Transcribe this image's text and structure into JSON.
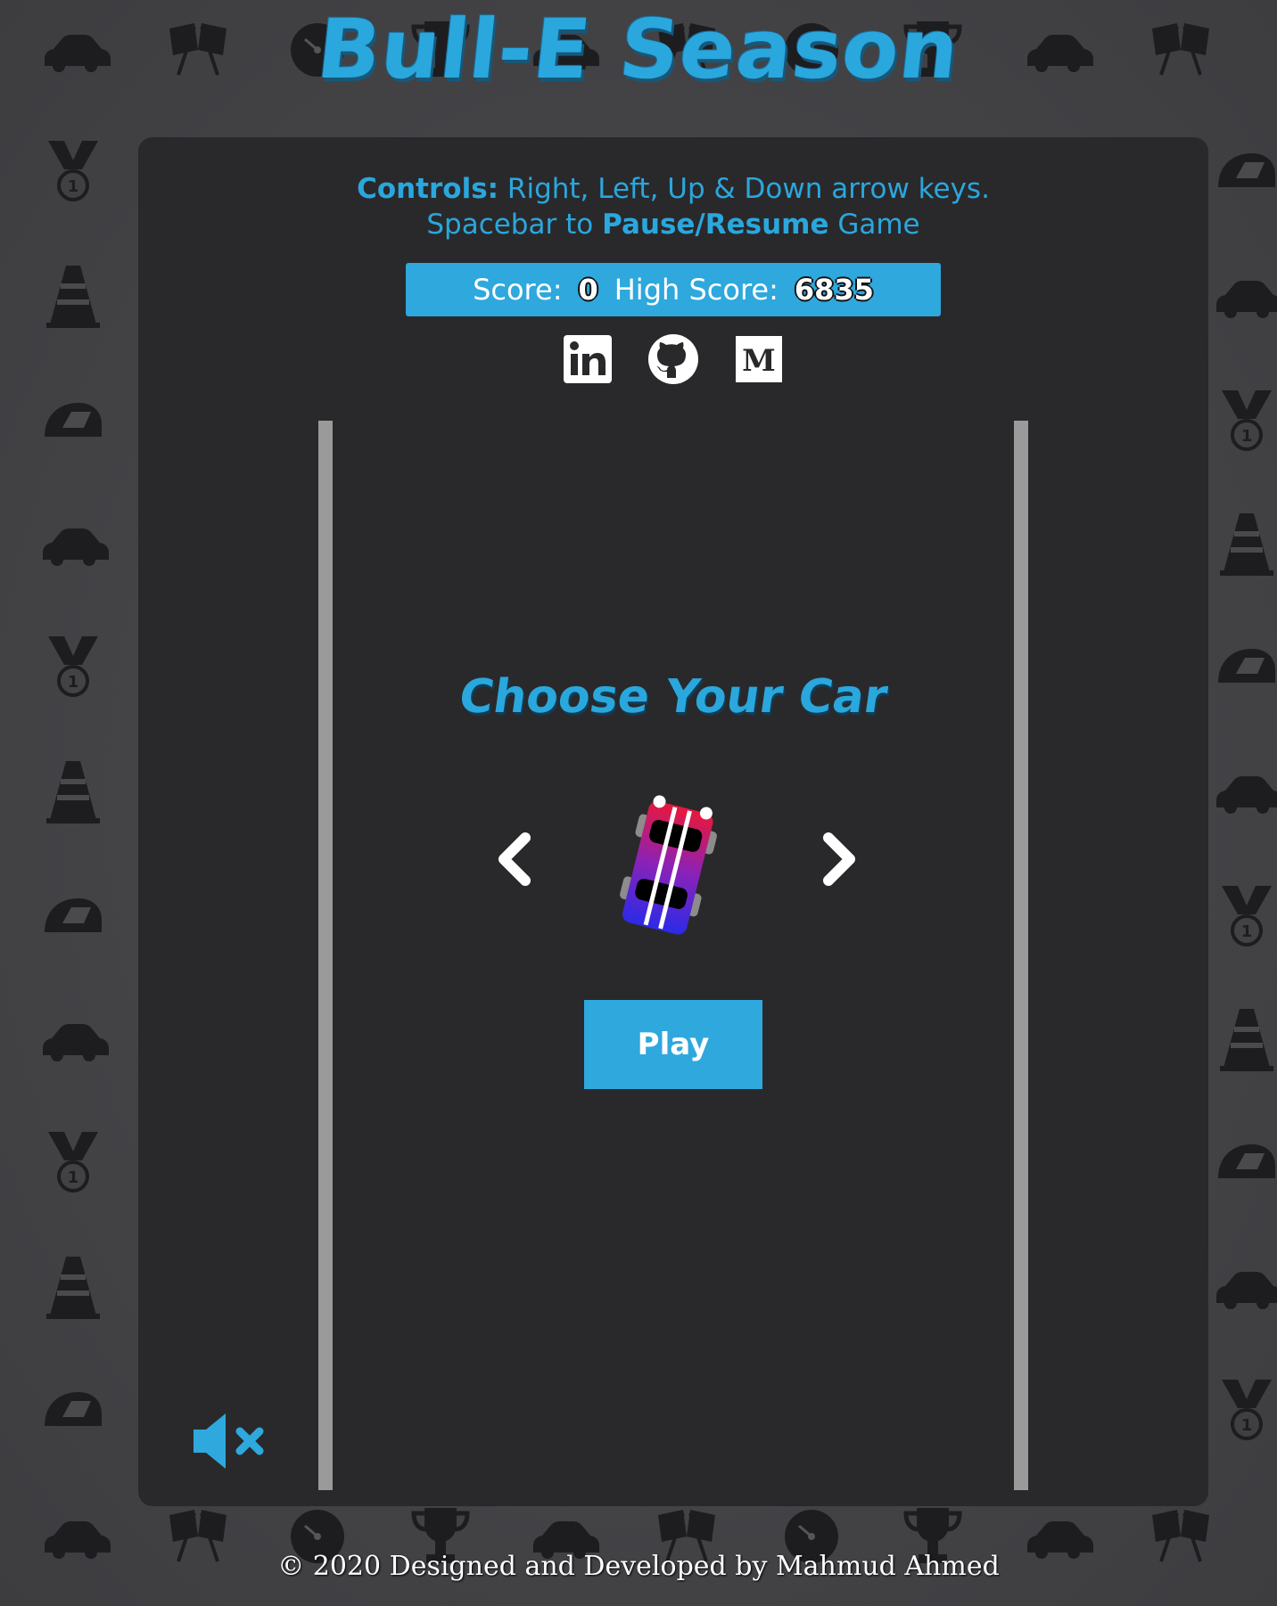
{
  "game": {
    "title": "Bull-E Season",
    "controls": {
      "line1_label": "Controls:",
      "line1_text": " Right, Left, Up & Down arrow keys.",
      "line2_prefix": "Spacebar to ",
      "line2_bold": "Pause/Resume",
      "line2_suffix": " Game"
    },
    "score": {
      "score_label": "Score:",
      "score_value": "0",
      "high_label": "High Score:",
      "high_value": "6835"
    },
    "car_select": {
      "heading": "Choose Your Car",
      "play_label": "Play"
    },
    "footer": "© 2020 Designed and Developed by Mahmud Ahmed"
  },
  "icons": {
    "social": [
      "linkedin-icon",
      "github-icon",
      "medium-icon"
    ],
    "background": [
      "car-icon",
      "checkered-flag-icon",
      "speedometer-icon",
      "trophy-icon",
      "medal-icon",
      "traffic-cone-icon",
      "helmet-icon"
    ],
    "navigation": [
      "chevron-left-icon",
      "chevron-right-icon"
    ],
    "sound": "muted-speaker-icon"
  },
  "colors": {
    "accent": "#2ea8dd",
    "panel": "#29292b",
    "rail": "#9a9a9a"
  }
}
